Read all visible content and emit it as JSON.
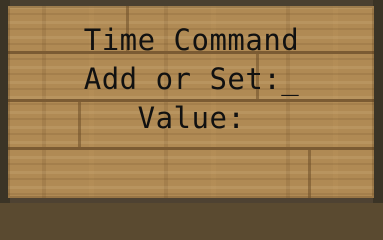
{
  "sign": {
    "lines": [
      "Time Command",
      "Add or Set:_",
      "Value:",
      ""
    ]
  }
}
